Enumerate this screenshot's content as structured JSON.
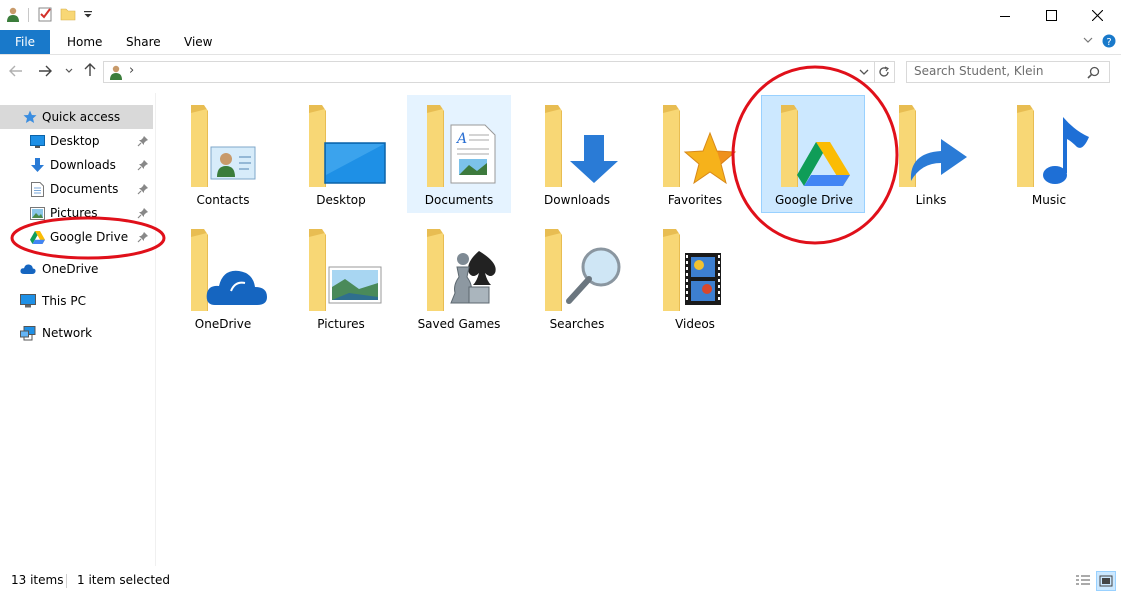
{
  "ribbon": {
    "file": "File",
    "home": "Home",
    "share": "Share",
    "view": "View"
  },
  "address": {
    "breadcrumb_separator": "›"
  },
  "search": {
    "placeholder": "Search Student, Klein"
  },
  "sidebar": {
    "items": [
      {
        "label": "Quick access",
        "icon": "star-icon",
        "pinned": false,
        "selected": true
      },
      {
        "label": "Desktop",
        "icon": "desktop-icon",
        "pinned": true
      },
      {
        "label": "Downloads",
        "icon": "download-arrow-icon",
        "pinned": true
      },
      {
        "label": "Documents",
        "icon": "document-icon",
        "pinned": true
      },
      {
        "label": "Pictures",
        "icon": "pictures-icon",
        "pinned": true
      },
      {
        "label": "Google Drive",
        "icon": "google-drive-icon",
        "pinned": true
      },
      {
        "label": "OneDrive",
        "icon": "cloud-icon"
      },
      {
        "label": "This PC",
        "icon": "computer-icon"
      },
      {
        "label": "Network",
        "icon": "network-icon"
      }
    ]
  },
  "folders": [
    {
      "label": "Contacts",
      "icon": "contacts-folder-icon"
    },
    {
      "label": "Desktop",
      "icon": "desktop-folder-icon"
    },
    {
      "label": "Documents",
      "icon": "documents-folder-icon",
      "state": "hover"
    },
    {
      "label": "Downloads",
      "icon": "downloads-folder-icon"
    },
    {
      "label": "Favorites",
      "icon": "favorites-folder-icon"
    },
    {
      "label": "Google Drive",
      "icon": "google-drive-folder-icon",
      "state": "selected"
    },
    {
      "label": "Links",
      "icon": "links-folder-icon"
    },
    {
      "label": "Music",
      "icon": "music-folder-icon"
    },
    {
      "label": "OneDrive",
      "icon": "onedrive-folder-icon"
    },
    {
      "label": "Pictures",
      "icon": "pictures-folder-icon"
    },
    {
      "label": "Saved Games",
      "icon": "saved-games-folder-icon"
    },
    {
      "label": "Searches",
      "icon": "searches-folder-icon"
    },
    {
      "label": "Videos",
      "icon": "videos-folder-icon"
    }
  ],
  "status": {
    "item_count": "13 items",
    "selection": "1 item selected"
  },
  "colors": {
    "accent": "#1979ca",
    "selection_bg": "#cce8ff",
    "selection_border": "#99d1ff",
    "hover_bg": "#e5f3ff",
    "folder": "#f8d775",
    "annotation": "#e0101a"
  }
}
